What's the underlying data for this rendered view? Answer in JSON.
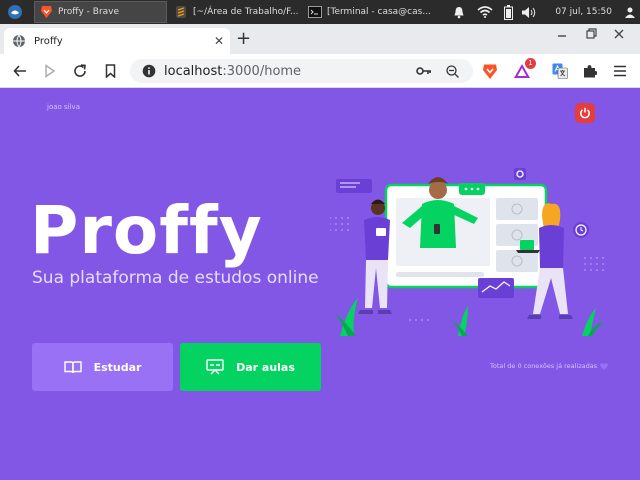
{
  "taskbar": {
    "windows": [
      {
        "title": "Proffy - Brave",
        "active": true
      },
      {
        "title": "[~/Área de Trabalho/F...",
        "active": false
      },
      {
        "title": "[Terminal - casa@cas...",
        "active": false
      }
    ],
    "clock": "07 jul, 15:50"
  },
  "browser": {
    "tab_title": "Proffy",
    "url_host": "localhost",
    "url_path": ":3000/home",
    "extension_badge": "1"
  },
  "page": {
    "user_name": "joao silva",
    "logo_text": "Proffy",
    "tagline": "Sua plataforma de estudos online",
    "study_button": "Estudar",
    "give_classes_button": "Dar aulas",
    "total_connections": "Total de 0 conexões já realizadas"
  },
  "colors": {
    "primary": "#8257e5",
    "primary_light": "#9871f5",
    "secondary": "#04d361",
    "logout": "#e33d3d"
  }
}
